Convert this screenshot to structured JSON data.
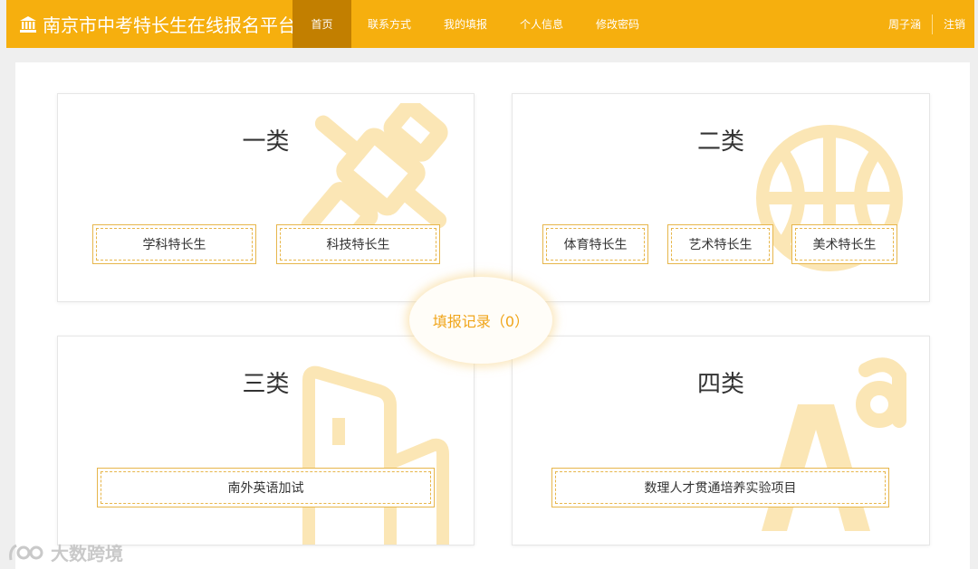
{
  "header": {
    "brand_title": "南京市中考特长生在线报名平台",
    "nav": [
      "首页",
      "联系方式",
      "我的填报",
      "个人信息",
      "修改密码"
    ],
    "user_name": "周子涵",
    "logout_label": "注销"
  },
  "categories": [
    {
      "title": "一类",
      "watermark_icon": "satellite-icon",
      "options": [
        "学科特长生",
        "科技特长生"
      ]
    },
    {
      "title": "二类",
      "watermark_icon": "basketball-icon",
      "options": [
        "体育特长生",
        "艺术特长生",
        "美术特长生"
      ]
    },
    {
      "title": "三类",
      "watermark_icon": "building-icon",
      "options": [
        "南外英语加试"
      ]
    },
    {
      "title": "四类",
      "watermark_icon": "letters-aa-icon",
      "options": [
        "数理人才贯通培养实验项目"
      ]
    }
  ],
  "records_label": "填报记录（0）",
  "footer_watermark": "大数跨境",
  "colors": {
    "accent": "#f6af0e",
    "nav_active": "#c27f00",
    "button_border": "#e7b64b",
    "records_text": "#f0a51a"
  }
}
